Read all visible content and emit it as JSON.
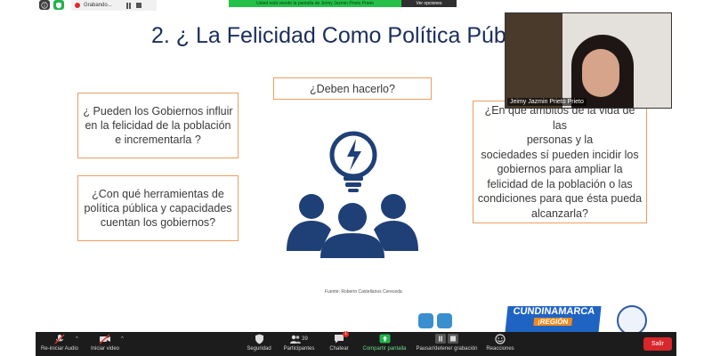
{
  "recording": {
    "label": "Grabando..."
  },
  "share_banner": "Usted está viendo la pantalla de Jeimy Jazmin Prieto Prieto",
  "view_options": "Ver opciones",
  "slide": {
    "title": "2. ¿ La Felicidad Como Política Púb",
    "box_deben": "¿Deben hacerlo?",
    "box_influir": "¿ Pueden los Gobiernos influir en la felicidad de la población e incrementarla ?",
    "box_herramientas": "¿Con qué herramientas de política pública y capacidades cuentan los gobiernos?",
    "box_ambitos_lines": [
      "¿En que ámbitos de la vida de las",
      "personas y la",
      "sociedades sí pueden incidir los",
      "gobiernos para ampliar la",
      "felicidad de la población o las",
      "condiciones para que ésta pueda",
      "alcanzarla?"
    ],
    "source": "Fuente: Roberto Castellanos Cereceda",
    "logo_cundinamarca": "CUNDINAMARCA",
    "logo_region": "¡REGIÓN"
  },
  "webcam": {
    "name": "Jeimy Jazmin Prieto Prieto"
  },
  "toolbar": {
    "audio": "Re-iniciar Audio",
    "video": "Iniciar video",
    "security": "Seguridad",
    "participants": "Participantes",
    "participants_count": "39",
    "chat": "Chatear",
    "chat_badge": "1",
    "share": "Compartir pantalla",
    "pause_rec": "Pausar/detener grabación",
    "reactions": "Reacciones",
    "exit": "Salir"
  },
  "colors": {
    "title": "#1a2e5c",
    "box_border": "#ed9d62",
    "icon": "#1f3f77",
    "share_banner": "#25c04a",
    "exit": "#d8262b"
  }
}
